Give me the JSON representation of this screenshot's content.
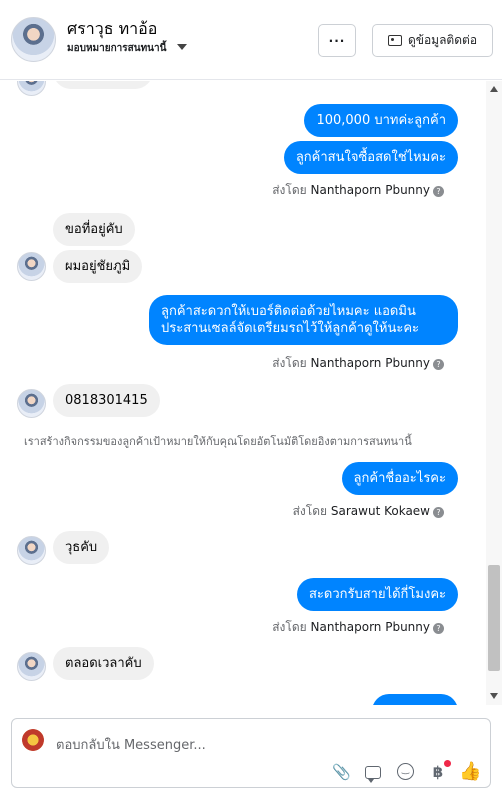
{
  "header": {
    "name": "ศราวุธ ทาอ้อ",
    "status": "มอบหมายการสนทนานี้",
    "more_label": "···",
    "contact_label": "ดูข้อมูลติดต่อ"
  },
  "messages": {
    "m1": "100,000 บาทค่ะลูกค้า",
    "m2": "ลูกค้าสนใจซื้อสดใช่ไหมคะ",
    "sent1": "ส่งโดย",
    "sent1_name": "Nanthaporn Pbunny",
    "m3": "ขอที่อยู่คับ",
    "m4": "ผมอยู่ชัยภูมิ",
    "m5_line1": "ลูกค้าสะดวกให้เบอร์ติดต่อด้วยไหมคะ แอดมิน",
    "m5_line2": "ประสานเซลล์จัดเตรียมรถไว้ให้ลูกค้าดูให้นะคะ",
    "sent2": "ส่งโดย",
    "sent2_name": "Nanthaporn Pbunny",
    "m6": "0818301415",
    "system_note": "เราสร้างกิจกรรมของลูกค้าเป้าหมายให้กับคุณโดยอัตโนมัติโดยอิงตามการสนทนานี้",
    "m7": "ลูกค้าชื่ออะไรคะ",
    "sent3": "ส่งโดย",
    "sent3_name": "Sarawut Kokaew",
    "m8": "วุธคับ",
    "m9": "สะดวกรับสายได้กี่โมงคะ",
    "sent4": "ส่งโดย",
    "sent4_name": "Nanthaporn Pbunny",
    "m10": "ตลอดเวลาคับ"
  },
  "composer": {
    "placeholder": "ตอบกลับใน Messenger..."
  },
  "colors": {
    "outgoing_bubble": "#0084ff",
    "incoming_bubble": "#f0f0f0",
    "notification_dot": "#f02849"
  }
}
